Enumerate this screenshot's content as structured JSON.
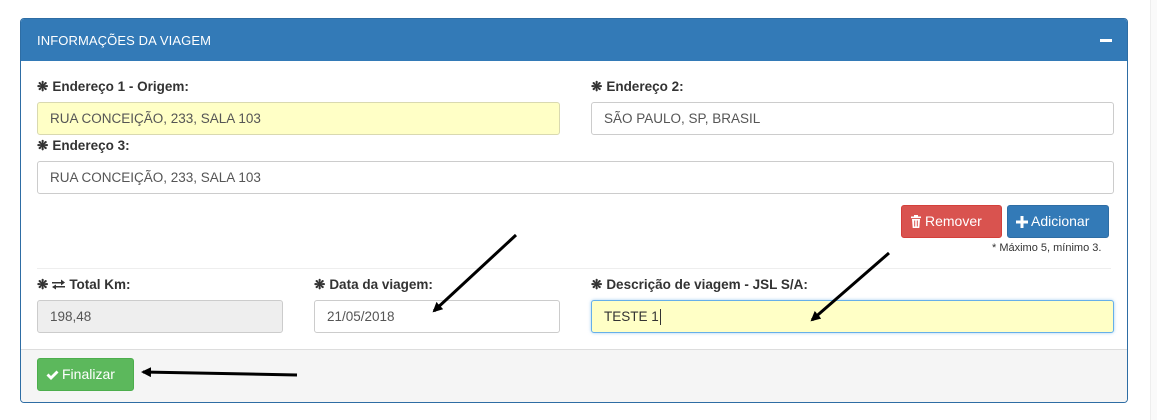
{
  "panel": {
    "title": "INFORMAÇÕES DA VIAGEM"
  },
  "fields": {
    "endereco1": {
      "label": "Endereço 1 - Origem:",
      "value": "RUA CONCEIÇÃO, 233, SALA 103"
    },
    "endereco2": {
      "label": "Endereço 2:",
      "value": "SÃO PAULO, SP, BRASIL"
    },
    "endereco3": {
      "label": "Endereço 3:",
      "value": "RUA CONCEIÇÃO, 233, SALA 103"
    },
    "total_km": {
      "label": "Total Km:",
      "value": "198,48"
    },
    "data_viagem": {
      "label": "Data da viagem:",
      "value": "21/05/2018"
    },
    "descricao": {
      "label": "Descrição de viagem - JSL S/A:",
      "value": "TESTE 1"
    }
  },
  "required_marker": "❋",
  "buttons": {
    "remover": "Remover",
    "adicionar": "Adicionar",
    "finalizar": "Finalizar"
  },
  "address_note": "* Máximo 5, mínimo 3.",
  "icons": {
    "collapse": "minus-icon",
    "remover": "trash-icon",
    "adicionar": "plus-icon",
    "finalizar": "check-icon",
    "total_km": "exchange-icon"
  },
  "colors": {
    "primary": "#337ab7",
    "danger": "#d9534f",
    "success": "#5cb85c",
    "highlight": "#ffffc6"
  }
}
